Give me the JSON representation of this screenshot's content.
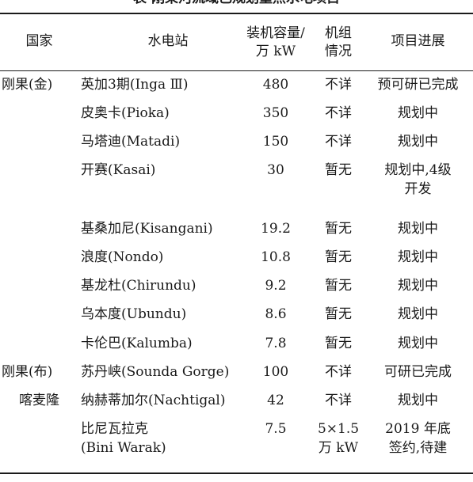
{
  "caption_partial": "表    刚果河流域已规划重点水电项目",
  "header": {
    "country": "国家",
    "station": "水电站",
    "capacity_line1": "装机容量/",
    "capacity_line2": "万 kW",
    "unit_line1": "机组",
    "unit_line2": "情况",
    "progress": "项目进展"
  },
  "rows": [
    {
      "country": "刚果(金)",
      "station": "英加3期(Inga Ⅲ)",
      "capacity": "480",
      "units": "不详",
      "progress": "预可研已完成"
    },
    {
      "country": "",
      "station": "皮奥卡(Pioka)",
      "capacity": "350",
      "units": "不详",
      "progress": "规划中"
    },
    {
      "country": "",
      "station": "马塔迪(Matadi)",
      "capacity": "150",
      "units": "不详",
      "progress": "规划中"
    },
    {
      "country": "",
      "station": "开赛(Kasai)",
      "capacity": "30",
      "units": "暂无",
      "progress_line1": "规划中,4级",
      "progress_line2": "开发"
    },
    {
      "country": "",
      "station": "基桑加尼(Kisangani)",
      "capacity": "19.2",
      "units": "暂无",
      "progress": "规划中"
    },
    {
      "country": "",
      "station": "浪度(Nondo)",
      "capacity": "10.8",
      "units": "暂无",
      "progress": "规划中"
    },
    {
      "country": "",
      "station": "基龙杜(Chirundu)",
      "capacity": "9.2",
      "units": "暂无",
      "progress": "规划中"
    },
    {
      "country": "",
      "station": "乌本度(Ubundu)",
      "capacity": "8.6",
      "units": "暂无",
      "progress": "规划中"
    },
    {
      "country": "",
      "station": "卡伦巴(Kalumba)",
      "capacity": "7.8",
      "units": "暂无",
      "progress": "规划中"
    },
    {
      "country": "刚果(布)",
      "station": "苏丹峡(Sounda Gorge)",
      "capacity": "100",
      "units": "不详",
      "progress": "可研已完成"
    },
    {
      "country": "喀麦隆",
      "station": "纳赫蒂加尔(Nachtigal)",
      "capacity": "42",
      "units": "不详",
      "progress": "规划中"
    },
    {
      "country": "",
      "station_line1": "比尼瓦拉克",
      "station_line2": "(Bini Warak)",
      "capacity": "7.5",
      "units_line1": "5×1.5",
      "units_line2": "万 kW",
      "progress_line1": "2019 年底",
      "progress_line2": "签约,待建"
    }
  ]
}
